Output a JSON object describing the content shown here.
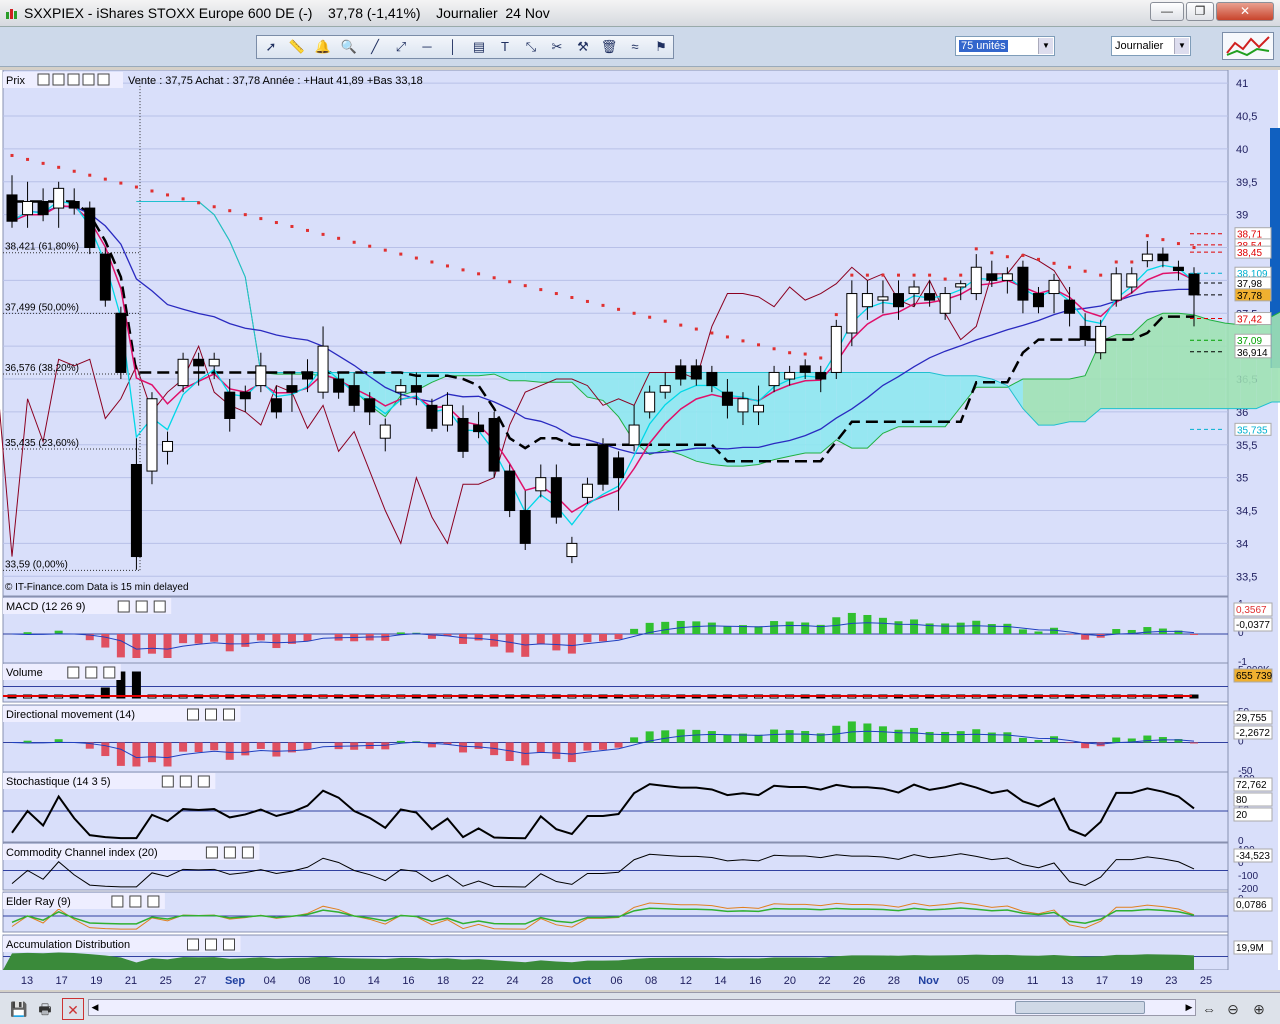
{
  "window": {
    "title": "SXXPIEX - iShares STOXX Europe 600 DE (-)    37,78 (-1,41%)    Journalier  24 Nov",
    "minimize": "—",
    "restore": "❐",
    "close": "✕"
  },
  "toolbar": {
    "units_select": "75 unités",
    "period_select": "Journalier",
    "icons": [
      "cursor-icon",
      "ruler-icon",
      "alarm-icon",
      "zoom-icon",
      "line-icon",
      "trendline-icon",
      "horizontal-line-icon",
      "vertical-line-icon",
      "fibonacci-icon",
      "text-icon",
      "arrows-icon",
      "tools-icon",
      "hammer-icon",
      "trash-icon",
      "indicator-icon",
      "pattern-icon"
    ]
  },
  "colors": {
    "chart_bg": "#d9dffa",
    "cloud_green": "#9fe2b4",
    "cloud_cyan": "#8ee8f0",
    "sma_blue": "#2a2ac0",
    "ema_magenta": "#e0106a",
    "cyan_line": "#00d8e8",
    "stop_green": "#3ccc3c",
    "stop_red": "#e03030",
    "dark_red": "#8b0020"
  },
  "price_panel": {
    "name": "Prix",
    "info": "Vente : 37,75 Achat : 37,78  Année : +Haut 41,89 +Bas 33,18",
    "credit": "© IT-Finance.com  Data is 15 min delayed",
    "axis_ticks": [
      "41",
      "40,5",
      "40",
      "39,5",
      "39",
      "38,5",
      "38",
      "37,5",
      "37",
      "36,5",
      "36",
      "35,5",
      "35",
      "34,5",
      "34",
      "33,5"
    ],
    "fib_levels": [
      {
        "label": "38,421 (61,80%)",
        "value": 38.421
      },
      {
        "label": "37,499 (50,00%)",
        "value": 37.499
      },
      {
        "label": "36,576 (38,20%)",
        "value": 36.576
      },
      {
        "label": "35,435 (23,60%)",
        "value": 35.435
      },
      {
        "label": "33,59 (0,00%)",
        "value": 33.59
      }
    ],
    "value_labels": [
      {
        "text": "38,71",
        "value": 38.71,
        "color": "#e00000",
        "bg": "#ffffff"
      },
      {
        "text": "38,54",
        "value": 38.54,
        "color": "#e00000",
        "bg": "#ffffff"
      },
      {
        "text": "38,45",
        "value": 38.43,
        "color": "#e00000",
        "bg": "#ffffff"
      },
      {
        "text": "38,109",
        "value": 38.109,
        "color": "#00b0d0",
        "bg": "#ffffff"
      },
      {
        "text": "37,98",
        "value": 37.96,
        "color": "#000000",
        "bg": "#ffffff"
      },
      {
        "text": "37,78",
        "value": 37.78,
        "color": "#000000",
        "bg": "#f0b030"
      },
      {
        "text": "37,42",
        "value": 37.42,
        "color": "#e00000",
        "bg": "#ffffff"
      },
      {
        "text": "37,09",
        "value": 37.09,
        "color": "#00a000",
        "bg": "#ffffff"
      },
      {
        "text": "36,914",
        "value": 36.914,
        "color": "#000000",
        "bg": "#ffffff"
      },
      {
        "text": "35,735",
        "value": 35.735,
        "color": "#00b0d0",
        "bg": "#ffffff"
      }
    ]
  },
  "indicators": [
    {
      "name": "MACD (12 26 9)",
      "ticks": [
        "1",
        "0",
        "-1"
      ],
      "values": [
        "0,3567",
        "-0,0377"
      ]
    },
    {
      "name": "Volume",
      "ticks": [
        "5 000K"
      ],
      "values": [
        "655 739"
      ]
    },
    {
      "name": "Directional movement (14)",
      "ticks": [
        "50",
        "0",
        "-50"
      ],
      "values": [
        "29,755",
        "-2,2672"
      ]
    },
    {
      "name": "Stochastique (14 3 5)",
      "ticks": [
        "100",
        "50",
        "0"
      ],
      "values": [
        "72,762",
        "80",
        "20"
      ]
    },
    {
      "name": "Commodity Channel index (20)",
      "ticks": [
        "100",
        "0",
        "-100",
        "-200"
      ],
      "values": [
        "-34,523"
      ]
    },
    {
      "name": "Elder Ray (9)",
      "ticks": [
        "0"
      ],
      "values": [
        "0,0786"
      ]
    },
    {
      "name": "Accumulation Distribution",
      "ticks": [],
      "values": [
        "19,9M"
      ]
    }
  ],
  "x_axis": [
    "13",
    "17",
    "19",
    "21",
    "25",
    "27",
    "Sep",
    "04",
    "08",
    "10",
    "14",
    "16",
    "18",
    "22",
    "24",
    "28",
    "Oct",
    "06",
    "08",
    "12",
    "14",
    "16",
    "20",
    "22",
    "26",
    "28",
    "Nov",
    "05",
    "09",
    "11",
    "13",
    "17",
    "19",
    "23",
    "25"
  ],
  "chart_data": {
    "type": "candlestick",
    "title": "SXXPIEX - iShares STOXX Europe 600 DE (-)",
    "ylim": [
      33.2,
      41.2
    ],
    "candles": [
      {
        "o": 39.3,
        "h": 39.6,
        "l": 38.8,
        "c": 38.9
      },
      {
        "o": 39.0,
        "h": 39.5,
        "l": 38.8,
        "c": 39.2
      },
      {
        "o": 39.2,
        "h": 39.4,
        "l": 38.9,
        "c": 39.0
      },
      {
        "o": 39.1,
        "h": 39.5,
        "l": 38.8,
        "c": 39.4
      },
      {
        "o": 39.2,
        "h": 39.4,
        "l": 39.0,
        "c": 39.1
      },
      {
        "o": 39.1,
        "h": 39.2,
        "l": 38.4,
        "c": 38.5
      },
      {
        "o": 38.4,
        "h": 38.5,
        "l": 37.6,
        "c": 37.7
      },
      {
        "o": 37.5,
        "h": 37.6,
        "l": 36.5,
        "c": 36.6
      },
      {
        "o": 35.2,
        "h": 35.6,
        "l": 33.6,
        "c": 33.8
      },
      {
        "o": 35.1,
        "h": 36.3,
        "l": 34.9,
        "c": 36.2
      },
      {
        "o": 35.4,
        "h": 35.7,
        "l": 35.2,
        "c": 35.55
      },
      {
        "o": 36.4,
        "h": 36.9,
        "l": 36.3,
        "c": 36.8
      },
      {
        "o": 36.8,
        "h": 36.9,
        "l": 36.4,
        "c": 36.7
      },
      {
        "o": 36.7,
        "h": 36.9,
        "l": 36.5,
        "c": 36.8
      },
      {
        "o": 36.3,
        "h": 36.5,
        "l": 35.7,
        "c": 35.9
      },
      {
        "o": 36.3,
        "h": 36.4,
        "l": 36.0,
        "c": 36.2
      },
      {
        "o": 36.4,
        "h": 36.9,
        "l": 36.3,
        "c": 36.7
      },
      {
        "o": 36.2,
        "h": 36.4,
        "l": 35.9,
        "c": 36.0
      },
      {
        "o": 36.4,
        "h": 36.6,
        "l": 36.0,
        "c": 36.3
      },
      {
        "o": 36.6,
        "h": 36.8,
        "l": 36.3,
        "c": 36.5
      },
      {
        "o": 36.3,
        "h": 37.3,
        "l": 36.2,
        "c": 37.0
      },
      {
        "o": 36.5,
        "h": 36.6,
        "l": 36.2,
        "c": 36.3
      },
      {
        "o": 36.4,
        "h": 36.6,
        "l": 36.0,
        "c": 36.1
      },
      {
        "o": 36.2,
        "h": 36.3,
        "l": 35.8,
        "c": 36.0
      },
      {
        "o": 35.6,
        "h": 35.9,
        "l": 35.4,
        "c": 35.8
      },
      {
        "o": 36.3,
        "h": 36.5,
        "l": 36.1,
        "c": 36.4
      },
      {
        "o": 36.4,
        "h": 36.6,
        "l": 36.1,
        "c": 36.3
      },
      {
        "o": 36.1,
        "h": 36.2,
        "l": 35.7,
        "c": 35.75
      },
      {
        "o": 35.8,
        "h": 36.3,
        "l": 35.7,
        "c": 36.1
      },
      {
        "o": 35.9,
        "h": 36.1,
        "l": 35.3,
        "c": 35.4
      },
      {
        "o": 35.8,
        "h": 36.0,
        "l": 35.6,
        "c": 35.7
      },
      {
        "o": 35.9,
        "h": 36.0,
        "l": 35.0,
        "c": 35.1
      },
      {
        "o": 35.1,
        "h": 35.2,
        "l": 34.4,
        "c": 34.5
      },
      {
        "o": 34.5,
        "h": 34.8,
        "l": 33.9,
        "c": 34.0
      },
      {
        "o": 34.8,
        "h": 35.2,
        "l": 34.7,
        "c": 35.0
      },
      {
        "o": 35.0,
        "h": 35.2,
        "l": 34.3,
        "c": 34.4
      },
      {
        "o": 33.8,
        "h": 34.1,
        "l": 33.7,
        "c": 34.0
      },
      {
        "o": 34.7,
        "h": 35.0,
        "l": 34.6,
        "c": 34.9
      },
      {
        "o": 35.5,
        "h": 35.6,
        "l": 34.8,
        "c": 34.9
      },
      {
        "o": 35.3,
        "h": 35.4,
        "l": 34.5,
        "c": 35.0
      },
      {
        "o": 35.5,
        "h": 36.1,
        "l": 35.4,
        "c": 35.8
      },
      {
        "o": 36.0,
        "h": 36.4,
        "l": 35.9,
        "c": 36.3
      },
      {
        "o": 36.3,
        "h": 36.6,
        "l": 36.2,
        "c": 36.4
      },
      {
        "o": 36.7,
        "h": 36.8,
        "l": 36.4,
        "c": 36.5
      },
      {
        "o": 36.7,
        "h": 36.8,
        "l": 36.4,
        "c": 36.5
      },
      {
        "o": 36.6,
        "h": 36.7,
        "l": 36.3,
        "c": 36.4
      },
      {
        "o": 36.3,
        "h": 36.5,
        "l": 35.9,
        "c": 36.1
      },
      {
        "o": 36.0,
        "h": 36.3,
        "l": 35.8,
        "c": 36.2
      },
      {
        "o": 36.0,
        "h": 36.4,
        "l": 35.8,
        "c": 36.1
      },
      {
        "o": 36.4,
        "h": 36.7,
        "l": 36.3,
        "c": 36.6
      },
      {
        "o": 36.5,
        "h": 36.7,
        "l": 36.4,
        "c": 36.6
      },
      {
        "o": 36.7,
        "h": 36.8,
        "l": 36.5,
        "c": 36.6
      },
      {
        "o": 36.6,
        "h": 36.7,
        "l": 36.3,
        "c": 36.5
      },
      {
        "o": 36.6,
        "h": 37.4,
        "l": 36.5,
        "c": 37.3
      },
      {
        "o": 37.2,
        "h": 38.0,
        "l": 37.0,
        "c": 37.8
      },
      {
        "o": 37.6,
        "h": 38.0,
        "l": 37.4,
        "c": 37.8
      },
      {
        "o": 37.7,
        "h": 38.0,
        "l": 37.5,
        "c": 37.75
      },
      {
        "o": 37.8,
        "h": 38.0,
        "l": 37.4,
        "c": 37.6
      },
      {
        "o": 37.8,
        "h": 38.0,
        "l": 37.6,
        "c": 37.9
      },
      {
        "o": 37.8,
        "h": 38.0,
        "l": 37.6,
        "c": 37.7
      },
      {
        "o": 37.5,
        "h": 37.9,
        "l": 37.4,
        "c": 37.8
      },
      {
        "o": 37.9,
        "h": 38.0,
        "l": 37.7,
        "c": 37.95
      },
      {
        "o": 37.8,
        "h": 38.4,
        "l": 37.7,
        "c": 38.2
      },
      {
        "o": 38.1,
        "h": 38.3,
        "l": 37.9,
        "c": 38.0
      },
      {
        "o": 38.0,
        "h": 38.2,
        "l": 37.8,
        "c": 38.1
      },
      {
        "o": 38.2,
        "h": 38.3,
        "l": 37.5,
        "c": 37.7
      },
      {
        "o": 37.8,
        "h": 37.9,
        "l": 37.5,
        "c": 37.6
      },
      {
        "o": 37.8,
        "h": 38.1,
        "l": 37.5,
        "c": 38.0
      },
      {
        "o": 37.7,
        "h": 37.9,
        "l": 37.3,
        "c": 37.5
      },
      {
        "o": 37.3,
        "h": 37.5,
        "l": 37.0,
        "c": 37.1
      },
      {
        "o": 36.9,
        "h": 37.4,
        "l": 36.8,
        "c": 37.3
      },
      {
        "o": 37.7,
        "h": 38.2,
        "l": 37.6,
        "c": 38.1
      },
      {
        "o": 37.9,
        "h": 38.2,
        "l": 37.8,
        "c": 38.1
      },
      {
        "o": 38.3,
        "h": 38.6,
        "l": 38.2,
        "c": 38.4
      },
      {
        "o": 38.4,
        "h": 38.5,
        "l": 38.2,
        "c": 38.3
      },
      {
        "o": 38.2,
        "h": 38.3,
        "l": 38.0,
        "c": 38.15
      },
      {
        "o": 38.1,
        "h": 38.2,
        "l": 37.3,
        "c": 37.78
      }
    ]
  }
}
